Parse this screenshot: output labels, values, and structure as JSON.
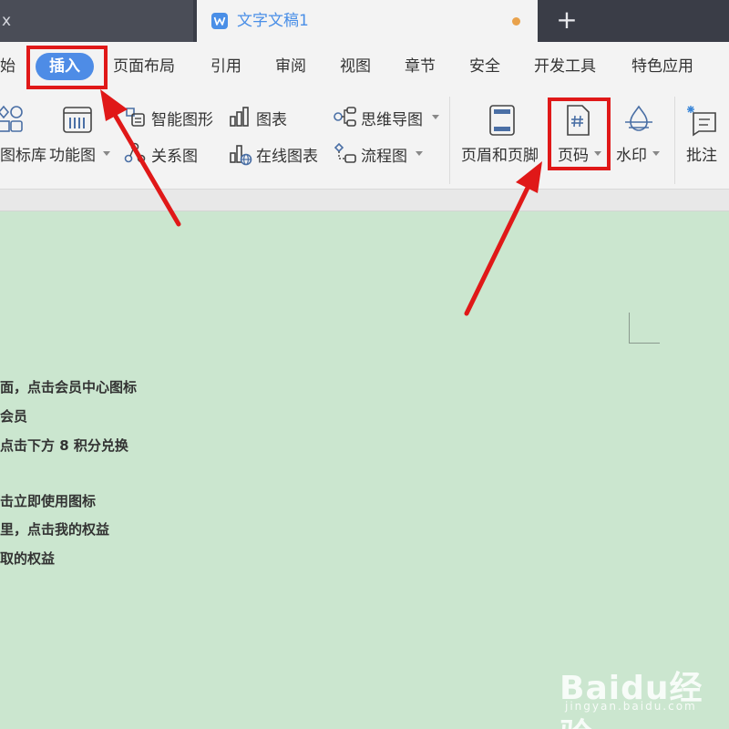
{
  "tabs": {
    "previous": "x",
    "active_title": "文字文稿1",
    "new_tab_glyph": "+"
  },
  "menu": {
    "items": [
      "始",
      "插入",
      "页面布局",
      "引用",
      "审阅",
      "视图",
      "章节",
      "安全",
      "开发工具",
      "特色应用"
    ],
    "active_index": 1,
    "accent": "#4e8ce6"
  },
  "ribbon": {
    "icon_library": "图标库",
    "function_diagram": "功能图",
    "smart_graphic": "智能图形",
    "relation_diagram": "关系图",
    "chart": "图表",
    "online_chart": "在线图表",
    "mind_map": "思维导图",
    "flowchart": "流程图",
    "header_footer": "页眉和页脚",
    "page_number": "页码",
    "watermark": "水印",
    "comment": "批注"
  },
  "document": {
    "lines": [
      "面，点击会员中心图标",
      "会员",
      "点击下方 8 积分兑换",
      "击立即使用图标",
      "里，点击我的权益",
      "取的权益"
    ]
  },
  "watermark": {
    "logo": "Baidu经验",
    "url": "jingyan.baidu.com"
  },
  "colors": {
    "highlight": "#e01818",
    "page_background": "#cbe6cf"
  }
}
